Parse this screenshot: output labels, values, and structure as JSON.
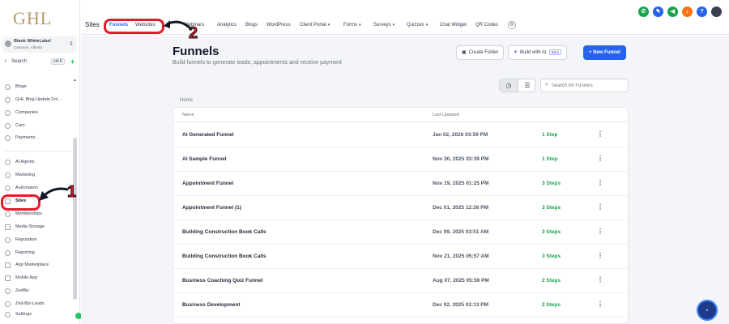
{
  "sidebar": {
    "logo": "GHL",
    "account_name": "Blank WhiteLabel",
    "account_location": "Canmore, Alberta",
    "search_label": "Search",
    "search_shortcut": "ctrl K",
    "items_top": [
      {
        "label": "Blogs"
      },
      {
        "label": "GHL Blog Update Fol..."
      },
      {
        "label": "Companies"
      },
      {
        "label": "Cars"
      },
      {
        "label": "Payments"
      }
    ],
    "items_main": [
      {
        "label": "AI Agents"
      },
      {
        "label": "Marketing"
      },
      {
        "label": "Automation"
      },
      {
        "label": "Sites",
        "active": true
      },
      {
        "label": "Memberships"
      },
      {
        "label": "Media Storage"
      },
      {
        "label": "Reputation"
      },
      {
        "label": "Reporting"
      },
      {
        "label": "App Marketplace"
      },
      {
        "label": "Mobile App"
      },
      {
        "label": "ZedBiz"
      },
      {
        "label": "Zed-Biz-Leads"
      },
      {
        "label": "Settings"
      }
    ]
  },
  "topnav": {
    "section": "Sites",
    "tabs": [
      {
        "label": "Funnels",
        "active": true
      },
      {
        "label": "Websites"
      },
      {
        "label": "Webinars"
      },
      {
        "label": "Analytics"
      },
      {
        "label": "Blogs"
      },
      {
        "label": "WordPress"
      },
      {
        "label": "Client Portal"
      },
      {
        "label": "Forms"
      },
      {
        "label": "Surveys"
      },
      {
        "label": "Quizzes"
      },
      {
        "label": "Chat Widget"
      },
      {
        "label": "QR Codes"
      }
    ]
  },
  "annotations": {
    "one": "1",
    "two": "2"
  },
  "main": {
    "title": "Funnels",
    "subtitle": "Build funnels to generate leads, appointments and receive payment",
    "create_folder": "Create Folder",
    "build_ai": "Build with AI",
    "beta": "Beta",
    "new_funnel": "+ New Funnel",
    "search_placeholder": "Search for Funnels",
    "breadcrumb": "Home",
    "columns": {
      "name": "Name",
      "updated": "Last Updated"
    },
    "rows": [
      {
        "name": "AI Generated Funnel",
        "updated": "Jan 02, 2026 03:59 PM",
        "steps": "1 Step"
      },
      {
        "name": "AI Sample Funnel",
        "updated": "Nov 20, 2025 03:39 PM",
        "steps": "1 Step"
      },
      {
        "name": "Appointment Funnel",
        "updated": "Nov 19, 2025 01:25 PM",
        "steps": "3 Steps"
      },
      {
        "name": "Appointment Funnel (1)",
        "updated": "Dec 01, 2025 12:36 PM",
        "steps": "3 Steps"
      },
      {
        "name": "Building Construction Book Calls",
        "updated": "Dec 09, 2025 03:51 AM",
        "steps": "3 Steps"
      },
      {
        "name": "Building Construction Book Calls",
        "updated": "Nov 21, 2025 05:57 AM",
        "steps": "3 Steps"
      },
      {
        "name": "Business Coaching Quiz Funnel",
        "updated": "Aug 07, 2025 05:59 PM",
        "steps": "2 Steps"
      },
      {
        "name": "Business Development",
        "updated": "Dec 02, 2025 02:13 PM",
        "steps": "2 Steps"
      }
    ]
  },
  "colors": {
    "accent": "#2563eb",
    "steps": "#16a34a",
    "annotation": "#e11d2a"
  }
}
